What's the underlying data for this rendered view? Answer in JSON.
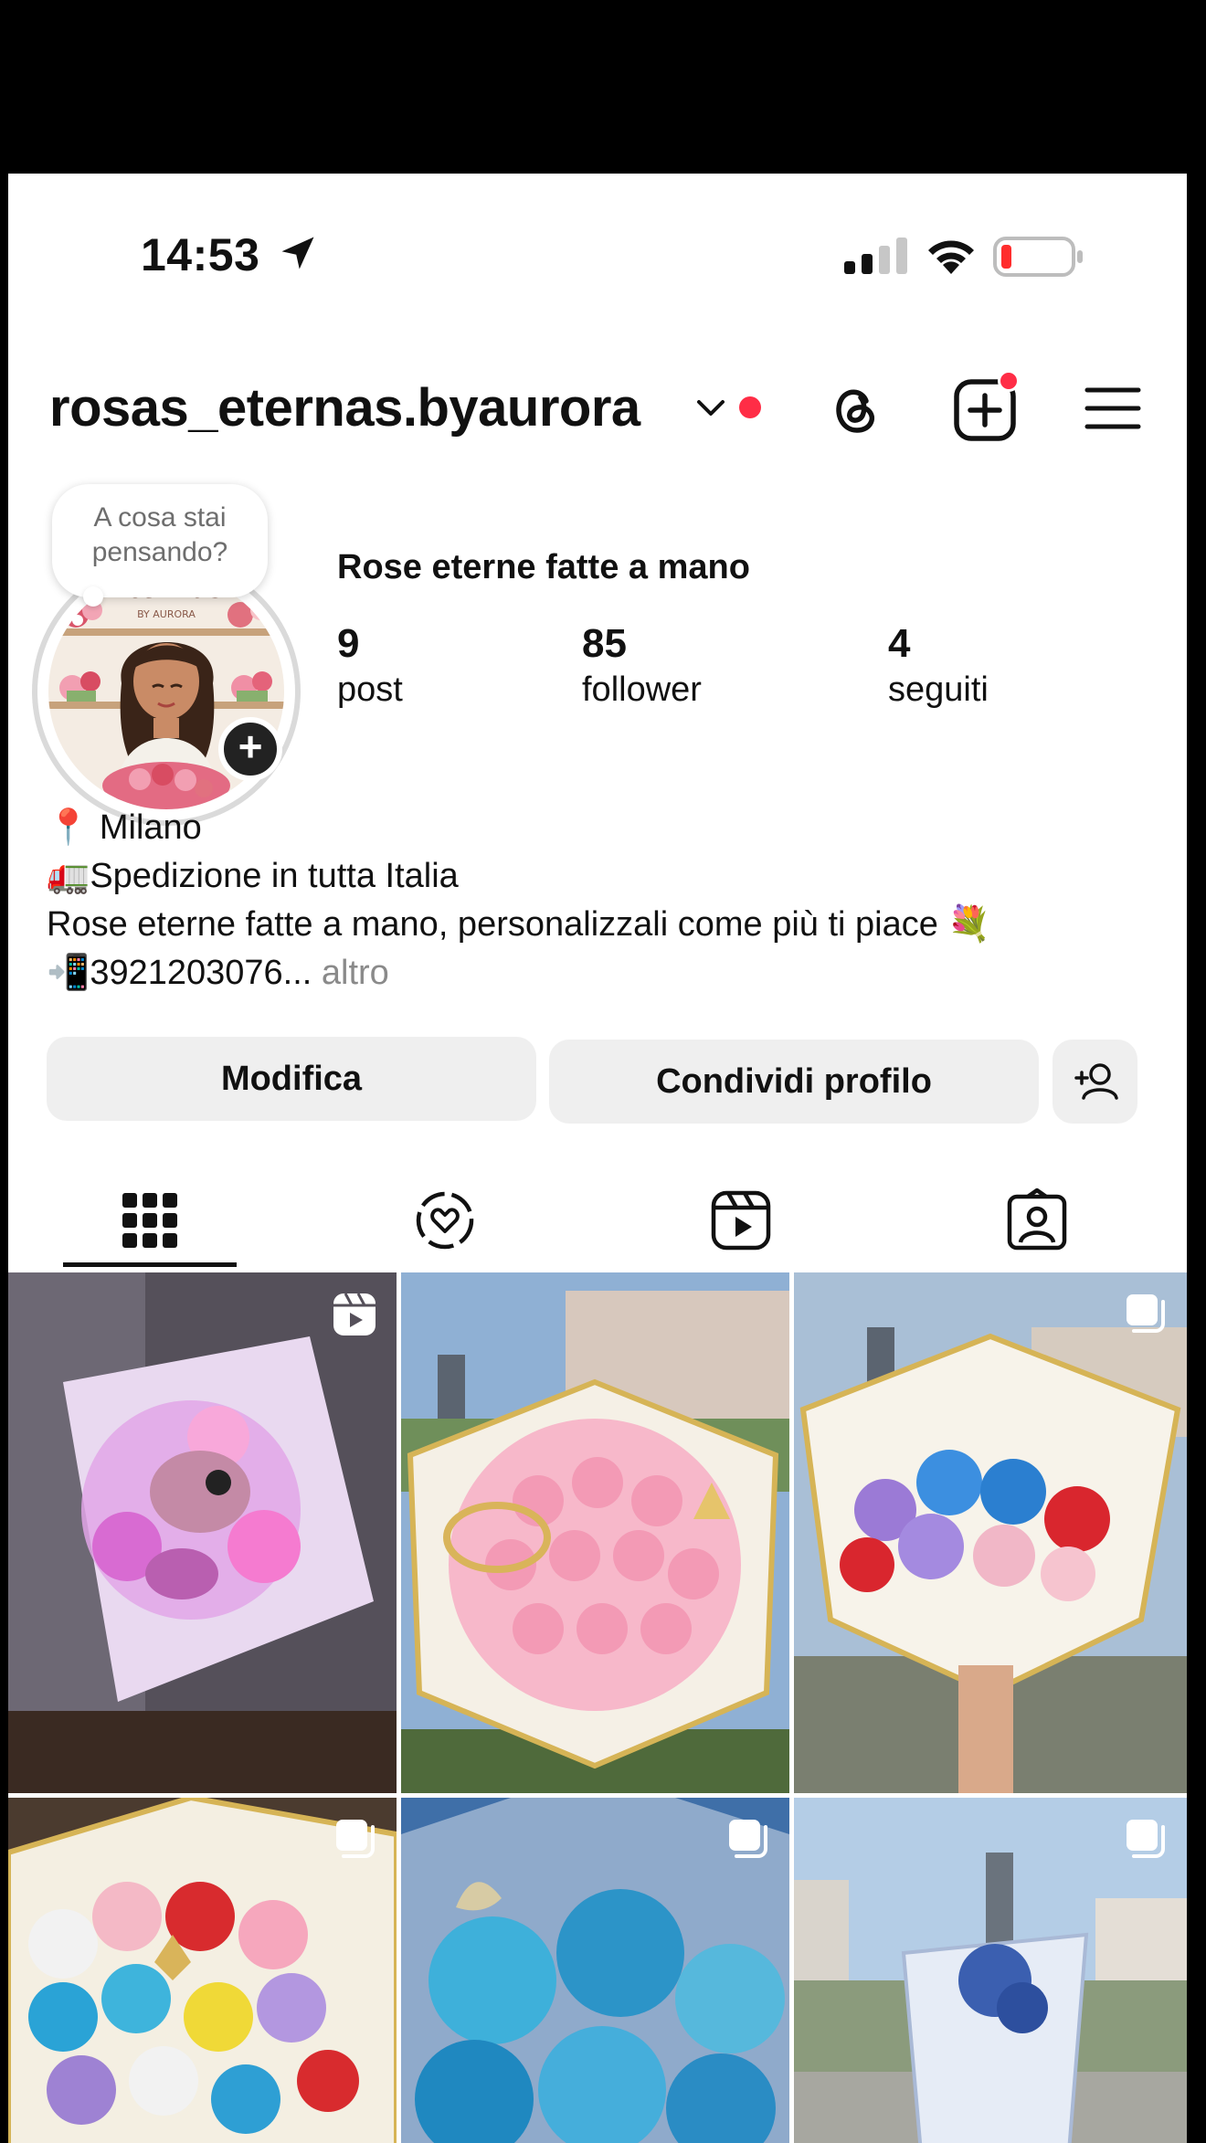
{
  "status_bar": {
    "time": "14:53",
    "icons": [
      "location-arrow-icon",
      "cellular-signal-icon",
      "wifi-icon",
      "battery-low-icon"
    ]
  },
  "header": {
    "username": "rosas_eternas.byaurora",
    "icons": [
      "chevron-down-icon",
      "notification-dot",
      "threads-icon",
      "new-post-icon",
      "menu-icon"
    ]
  },
  "profile": {
    "note_bubble": "A cosa stai pensando?",
    "avatar_caption": "Eternas",
    "avatar_subcaption": "BY AURORA",
    "display_name": "Rose eterne fatte a mano",
    "stats": [
      {
        "value": "9",
        "label": "post"
      },
      {
        "value": "85",
        "label": "follower"
      },
      {
        "value": "4",
        "label": "seguiti"
      }
    ],
    "bio": {
      "line1": "📍 Milano",
      "line2": "🚛Spedizione in tutta Italia",
      "line3": "Rose eterne fatte a mano, personalizzali  come più ti piace 💐",
      "line4": "📲3921203076...",
      "more": " altro"
    }
  },
  "actions": {
    "edit": "Modifica",
    "share": "Condividi profilo",
    "add_person_icon": "add-person-icon"
  },
  "tabs": [
    {
      "name": "grid",
      "icon": "grid-icon",
      "active": true
    },
    {
      "name": "collabs",
      "icon": "heart-circle-icon",
      "active": false
    },
    {
      "name": "reels",
      "icon": "reels-icon",
      "active": false
    },
    {
      "name": "tagged",
      "icon": "tagged-icon",
      "active": false
    }
  ],
  "posts": [
    {
      "badge": "reel-icon",
      "subject": "Stitch plush bouquet with lights",
      "colors": [
        "#6a6070",
        "#d9a7e0",
        "#f29fd6"
      ]
    },
    {
      "badge": "",
      "subject": "pink rose bouquet with crown",
      "colors": [
        "#8fa8c8",
        "#f6b7c9",
        "#e7c46a"
      ]
    },
    {
      "badge": "carousel-icon",
      "subject": "blue purple red rose bouquet",
      "colors": [
        "#9fb2c8",
        "#3f8dd6",
        "#d92a33"
      ]
    },
    {
      "badge": "carousel-icon",
      "subject": "rainbow rose bouquet with butterflies",
      "colors": [
        "#4a3a30",
        "#39a7d6",
        "#e8d43b"
      ]
    },
    {
      "badge": "carousel-icon",
      "subject": "light blue roses",
      "colors": [
        "#4f74a8",
        "#4bb2d8",
        "#2f86b8"
      ]
    },
    {
      "badge": "carousel-icon",
      "subject": "blue bouquet over city",
      "colors": [
        "#a9c3e0",
        "#6e7f8c",
        "#3c5fa3"
      ]
    }
  ]
}
